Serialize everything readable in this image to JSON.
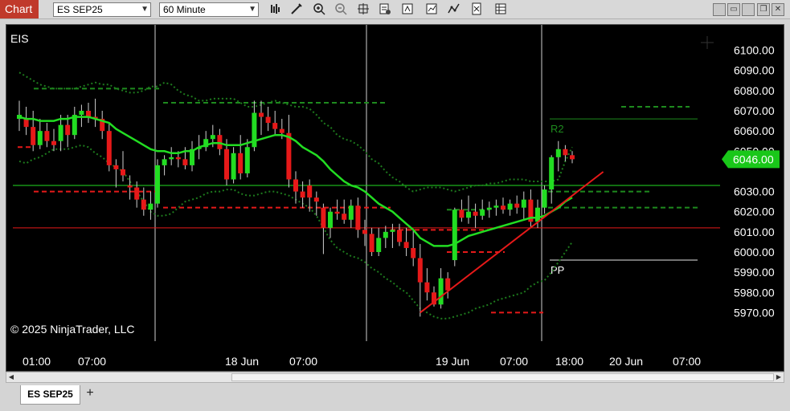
{
  "window": {
    "chart_tab_label": "Chart",
    "instrument": "ES SEP25",
    "interval": "60 Minute"
  },
  "toolbar_icons": [
    "bar-type-icon",
    "draw-tool-icon",
    "zoom-in-icon",
    "zoom-out-icon",
    "crosshair-icon",
    "properties-icon",
    "strategies-icon",
    "indicators-icon",
    "chart-trader-icon",
    "data-box-icon",
    "templates-icon"
  ],
  "window_buttons": [
    "minimize-icon",
    "restore-icon",
    "maximize-icon",
    "close-icon"
  ],
  "chart": {
    "symbol_label": "EIS",
    "copyright": "© 2025 NinjaTrader, LLC",
    "level_labels": {
      "r2": "R2",
      "pp": "PP"
    },
    "last_price": "6046.00",
    "colors": {
      "up": "#22dd22",
      "down": "#e61919",
      "doji": "#3399ff",
      "sma": "#22dd22",
      "band": "#1d7a1d",
      "price_badge": "#19c719"
    },
    "y_axis": {
      "min": 5963,
      "max": 6107,
      "ticks": [
        "6100.00",
        "6090.00",
        "6080.00",
        "6070.00",
        "6060.00",
        "6050.00",
        "6030.00",
        "6020.00",
        "6010.00",
        "6000.00",
        "5990.00",
        "5980.00",
        "5970.00"
      ]
    },
    "x_axis": {
      "ticks": [
        "01:00",
        "07:00",
        "18 Jun",
        "07:00",
        "19 Jun",
        "07:00",
        "18:00",
        "20 Jun",
        "07:00"
      ]
    }
  },
  "chart_data": {
    "type": "candlestick",
    "candles": [
      [
        6066,
        6075,
        6060,
        6068
      ],
      [
        6066,
        6072,
        6058,
        6062
      ],
      [
        6062,
        6070,
        6050,
        6053
      ],
      [
        6053,
        6066,
        6051,
        6060
      ],
      [
        6060,
        6064,
        6052,
        6055
      ],
      [
        6055,
        6061,
        6050,
        6053
      ],
      [
        6055,
        6068,
        6050,
        6063
      ],
      [
        6063,
        6068,
        6052,
        6058
      ],
      [
        6058,
        6072,
        6056,
        6068
      ],
      [
        6068,
        6073,
        6062,
        6070
      ],
      [
        6070,
        6074,
        6064,
        6067
      ],
      [
        6067,
        6076,
        6062,
        6066
      ],
      [
        6066,
        6070,
        6056,
        6060
      ],
      [
        6060,
        6064,
        6040,
        6043
      ],
      [
        6043,
        6046,
        6032,
        6041
      ],
      [
        6041,
        6050,
        6035,
        6038
      ],
      [
        6033,
        6038,
        6026,
        6032
      ],
      [
        6032,
        6035,
        6022,
        6026
      ],
      [
        6026,
        6032,
        6018,
        6021
      ],
      [
        6021,
        6030,
        6016,
        6024
      ],
      [
        6024,
        6046,
        6022,
        6043
      ],
      [
        6043,
        6048,
        6038,
        6046
      ],
      [
        6046,
        6052,
        6043,
        6047
      ],
      [
        6047,
        6050,
        6042,
        6046
      ],
      [
        6046,
        6052,
        6041,
        6043
      ],
      [
        6043,
        6055,
        6040,
        6051
      ],
      [
        6051,
        6058,
        6046,
        6052
      ],
      [
        6052,
        6060,
        6050,
        6056
      ],
      [
        6056,
        6063,
        6052,
        6058
      ],
      [
        6058,
        6061,
        6048,
        6051
      ],
      [
        6051,
        6056,
        6033,
        6036
      ],
      [
        6036,
        6052,
        6034,
        6049
      ],
      [
        6049,
        6058,
        6036,
        6039
      ],
      [
        6039,
        6056,
        6037,
        6052
      ],
      [
        6052,
        6075,
        6050,
        6069
      ],
      [
        6069,
        6075,
        6058,
        6067
      ],
      [
        6067,
        6072,
        6060,
        6064
      ],
      [
        6064,
        6070,
        6058,
        6061
      ],
      [
        6061,
        6066,
        6056,
        6059
      ],
      [
        6059,
        6068,
        6032,
        6036
      ],
      [
        6036,
        6040,
        6024,
        6030
      ],
      [
        6030,
        6035,
        6022,
        6027
      ],
      [
        6033,
        6036,
        6020,
        6027
      ],
      [
        6027,
        6030,
        6018,
        6025
      ],
      [
        6022,
        6024,
        5999,
        6012
      ],
      [
        6012,
        6022,
        6007,
        6020
      ],
      [
        6020,
        6026,
        6016,
        6019
      ],
      [
        6019,
        6026,
        6014,
        6016
      ],
      [
        6016,
        6026,
        6012,
        6023
      ],
      [
        6023,
        6027,
        6007,
        6011
      ],
      [
        6011,
        6016,
        6003,
        6009
      ],
      [
        6009,
        6012,
        5998,
        6000
      ],
      [
        6000,
        6012,
        5998,
        6007
      ],
      [
        6007,
        6013,
        6002,
        6010
      ],
      [
        6010,
        6014,
        6002,
        6011
      ],
      [
        6011,
        6014,
        6003,
        6005
      ],
      [
        6005,
        6012,
        5998,
        6002
      ],
      [
        6002,
        6011,
        5993,
        5997
      ],
      [
        5997,
        6004,
        5968,
        5985
      ],
      [
        5985,
        5992,
        5976,
        5980
      ],
      [
        5980,
        5983,
        5973,
        5974
      ],
      [
        5974,
        5992,
        5972,
        5987
      ],
      [
        5987,
        5990,
        5977,
        5981
      ],
      [
        5996,
        6022,
        5993,
        6021
      ],
      [
        6021,
        6026,
        6015,
        6017
      ],
      [
        6017,
        6028,
        6014,
        6020
      ],
      [
        6020,
        6024,
        6012,
        6018
      ],
      [
        6018,
        6026,
        6016,
        6021
      ],
      [
        6021,
        6025,
        6017,
        6022
      ],
      [
        6022,
        6026,
        6018,
        6023
      ],
      [
        6023,
        6027,
        6019,
        6021
      ],
      [
        6021,
        6026,
        6018,
        6024
      ],
      [
        6024,
        6028,
        6019,
        6022
      ],
      [
        6022,
        6030,
        6016,
        6026
      ],
      [
        6026,
        6031,
        6012,
        6015
      ],
      [
        6015,
        6026,
        6012,
        6022
      ],
      [
        6022,
        6033,
        6019,
        6031
      ],
      [
        6031,
        6048,
        6024,
        6047
      ],
      [
        6047,
        6055,
        6040,
        6051
      ],
      [
        6051,
        6053,
        6045,
        6048
      ],
      [
        6048,
        6050,
        6044,
        6046
      ]
    ],
    "sma": [
      6067,
      6066,
      6066,
      6065,
      6065,
      6065,
      6066,
      6066,
      6067,
      6067,
      6067,
      6066,
      6065,
      6064,
      6061,
      6059,
      6057,
      6055,
      6053,
      6051,
      6050,
      6050,
      6049,
      6049,
      6050,
      6050,
      6052,
      6053,
      6054,
      6054,
      6053,
      6053,
      6053,
      6054,
      6055,
      6056,
      6057,
      6058,
      6058,
      6057,
      6055,
      6052,
      6050,
      6048,
      6045,
      6041,
      6038,
      6035,
      6033,
      6032,
      6030,
      6027,
      6024,
      6022,
      6020,
      6017,
      6014,
      6011,
      6007,
      6005,
      6003,
      6003,
      6003,
      6004,
      6006,
      6008,
      6009,
      6010,
      6011,
      6012,
      6013,
      6014,
      6015,
      6016,
      6017,
      6017,
      6018,
      6020,
      6022,
      6025,
      6027
    ],
    "upper_band": [
      6089,
      6087,
      6085,
      6083,
      6082,
      6081,
      6081,
      6081,
      6081,
      6082,
      6083,
      6084,
      6083,
      6083,
      6081,
      6080,
      6079,
      6079,
      6080,
      6082,
      6082,
      6084,
      6083,
      6080,
      6078,
      6077,
      6075,
      6075,
      6076,
      6076,
      6076,
      6076,
      6074,
      6072,
      6072,
      6073,
      6074,
      6075,
      6074,
      6073,
      6072,
      6072,
      6071,
      6068,
      6064,
      6062,
      6058,
      6056,
      6055,
      6053,
      6050,
      6046,
      6044,
      6040,
      6037,
      6035,
      6032,
      6030,
      6031,
      6032,
      6032,
      6032,
      6031,
      6030,
      6031,
      6032,
      6033,
      6033,
      6034,
      6034,
      6035,
      6036,
      6036,
      6036,
      6035,
      6035,
      6035,
      6035,
      6036,
      6045,
      6052
    ],
    "lower_band": [
      6045,
      6044,
      6046,
      6047,
      6049,
      6051,
      6051,
      6051,
      6052,
      6053,
      6052,
      6049,
      6047,
      6044,
      6042,
      6040,
      6035,
      6030,
      6025,
      6020,
      6018,
      6018,
      6019,
      6022,
      6025,
      6026,
      6027,
      6029,
      6030,
      6030,
      6031,
      6031,
      6029,
      6028,
      6028,
      6029,
      6030,
      6030,
      6029,
      6028,
      6026,
      6024,
      6022,
      6018,
      6012,
      6006,
      6002,
      6000,
      5998,
      5997,
      5995,
      5992,
      5990,
      5987,
      5985,
      5982,
      5980,
      5976,
      5972,
      5970,
      5968,
      5967,
      5967,
      5968,
      5969,
      5970,
      5972,
      5973,
      5974,
      5976,
      5977,
      5978,
      5979,
      5980,
      5983,
      5985,
      5986,
      5990,
      5995,
      6000,
      6005
    ],
    "horizontal_lines": [
      6033,
      6012
    ],
    "pivot_levels": {
      "R2": 6066,
      "PP": 5996
    },
    "trendline": [
      [
        5970,
        58
      ],
      [
        6035,
        81
      ]
    ]
  }
}
